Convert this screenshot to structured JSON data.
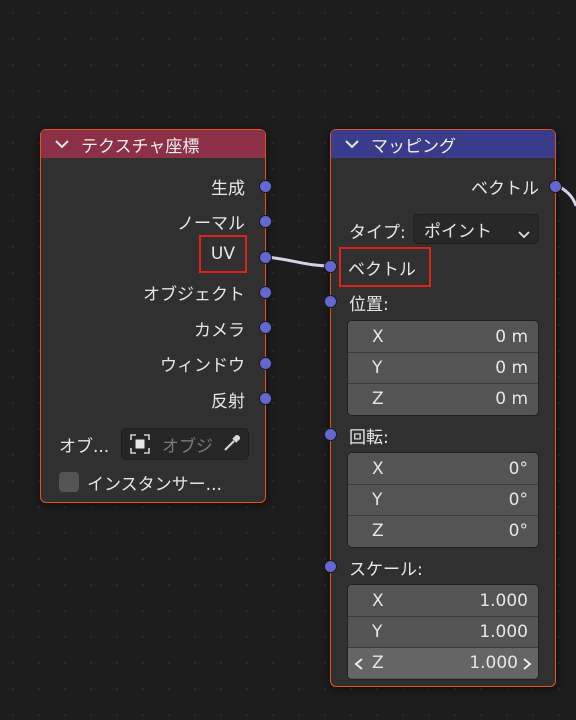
{
  "texture_coord_node": {
    "title": "テクスチャ座標",
    "outputs": [
      "生成",
      "ノーマル",
      "UV",
      "オブジェクト",
      "カメラ",
      "ウィンドウ",
      "反射"
    ],
    "object_label": "オブ...",
    "object_placeholder": "オブジ",
    "instancer_label": "インスタンサー..."
  },
  "mapping_node": {
    "title": "マッピング",
    "output_vector": "ベクトル",
    "type_label": "タイプ:",
    "type_value": "ポイント",
    "input_vector": "ベクトル",
    "location": {
      "label": "位置:",
      "fields": [
        {
          "axis": "X",
          "value": "0 m"
        },
        {
          "axis": "Y",
          "value": "0 m"
        },
        {
          "axis": "Z",
          "value": "0 m"
        }
      ]
    },
    "rotation": {
      "label": "回転:",
      "fields": [
        {
          "axis": "X",
          "value": "0°"
        },
        {
          "axis": "Y",
          "value": "0°"
        },
        {
          "axis": "Z",
          "value": "0°"
        }
      ]
    },
    "scale": {
      "label": "スケール:",
      "fields": [
        {
          "axis": "X",
          "value": "1.000"
        },
        {
          "axis": "Y",
          "value": "1.000"
        },
        {
          "axis": "Z",
          "value": "1.000"
        }
      ]
    }
  },
  "colors": {
    "texture_header": "#8c3048",
    "mapping_header": "#3b3b8c",
    "selection_border": "#e0531d",
    "highlight_box": "#e0231a",
    "socket_vector": "#6466d1",
    "link": "#d8d2e6"
  },
  "icons": [
    "chevron-down-icon",
    "object-icon",
    "eyedropper-icon",
    "left-arrow-icon",
    "right-arrow-icon"
  ]
}
